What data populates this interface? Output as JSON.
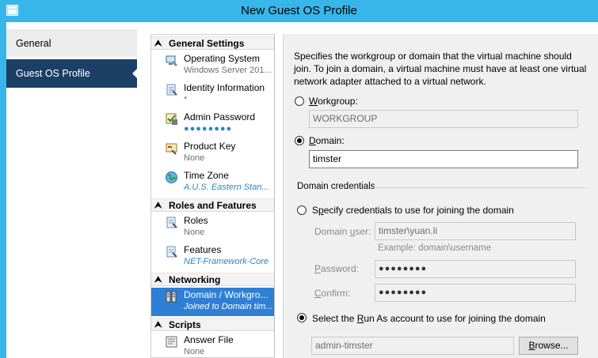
{
  "window": {
    "title": "New Guest OS Profile"
  },
  "nav": {
    "items": [
      {
        "label": "General"
      },
      {
        "label": "Guest OS Profile"
      }
    ]
  },
  "settings": {
    "sections": [
      {
        "title": "General Settings"
      },
      {
        "title": "Roles and Features"
      },
      {
        "title": "Networking"
      },
      {
        "title": "Scripts"
      }
    ],
    "items": [
      {
        "name": "Operating System",
        "value": "Windows Server 201...",
        "icon": "computer-icon"
      },
      {
        "name": "Identity Information",
        "value": "*",
        "icon": "identity-icon"
      },
      {
        "name": "Admin Password",
        "value": "●●●●●●●●",
        "icon": "password-icon"
      },
      {
        "name": "Product Key",
        "value": "None",
        "icon": "key-icon"
      },
      {
        "name": "Time Zone",
        "value": "A.U.S. Eastern Stan...",
        "icon": "globe-icon"
      },
      {
        "name": "Roles",
        "value": "None",
        "icon": "roles-icon"
      },
      {
        "name": "Features",
        "value": "NET-Framework-Core",
        "icon": "features-icon"
      },
      {
        "name": "Domain / Workgro...",
        "value": "Joined to Domain tim...",
        "icon": "network-icon"
      },
      {
        "name": "Answer File",
        "value": "None",
        "icon": "answer-file-icon"
      }
    ]
  },
  "content": {
    "description": "Specifies the workgroup or domain that the virtual machine should join.  To join a domain, a virtual machine must have at least one virtual network adapter attached to a virtual network.",
    "workgroup": {
      "label_first": "W",
      "label_rest": "orkgroup:",
      "value": "WORKGROUP"
    },
    "domain": {
      "label_first": "D",
      "label_rest": "omain:",
      "value": "timster"
    },
    "credentials_group": "Domain credentials",
    "specify_option": {
      "label_pre": "S",
      "label_u": "p",
      "label_rest": "ecify credentials to use for joining the domain"
    },
    "domain_user": {
      "label_pre": "Domain ",
      "label_u": "u",
      "label_rest": "ser:",
      "value": "timster\\yuan.li",
      "hint": "Example: domain\\username"
    },
    "password": {
      "label_u": "P",
      "label_rest": "assword:",
      "value": "●●●●●●●●"
    },
    "confirm": {
      "label_u": "C",
      "label_rest": "onfirm:",
      "value": "●●●●●●●●"
    },
    "runas_option": {
      "label_pre": "Select the ",
      "label_u": "R",
      "label_rest": "un As account to use for joining the domain"
    },
    "runas_account": {
      "value": "admin-timster"
    },
    "browse_button": {
      "label_u": "B",
      "label_rest": "rowse..."
    }
  },
  "colors": {
    "titlebar": "#37b6e9",
    "nav_selected": "#1c3f66",
    "item_selected": "#2f7fd5"
  }
}
